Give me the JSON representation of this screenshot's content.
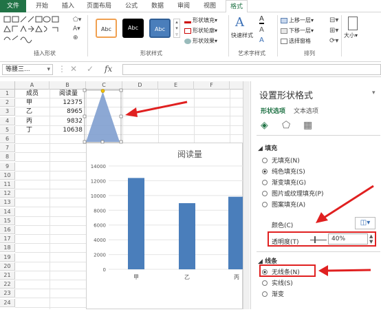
{
  "ribbon": {
    "tabs": [
      "文件",
      "开始",
      "插入",
      "页面布局",
      "公式",
      "数据",
      "审阅",
      "视图",
      "格式"
    ],
    "active_tab": "格式",
    "group_labels": {
      "insert_shapes": "插入形状",
      "shape_styles": "形状样式",
      "wordart": "艺术字样式",
      "arrange": "排列"
    },
    "style_samples": [
      "Abc",
      "Abc",
      "Abc"
    ],
    "shape_fill": "形状填充",
    "shape_outline": "形状轮廓",
    "shape_effects": "形状效果",
    "quick_styles": "快速样式",
    "bring_forward": "上移一层",
    "send_backward": "下移一层",
    "selection_pane": "选择窗格",
    "size": "大小"
  },
  "formula_bar": {
    "name_box": "等腰三...",
    "fx": "fx",
    "value": ""
  },
  "grid": {
    "columns": [
      "A",
      "B",
      "C",
      "D",
      "E",
      "F"
    ],
    "rows": [
      "1",
      "2",
      "3",
      "4",
      "5",
      "6",
      "7",
      "8",
      "9",
      "10",
      "11",
      "12",
      "13",
      "14",
      "15",
      "16",
      "17",
      "18",
      "19",
      "20",
      "21",
      "22",
      "23",
      "24"
    ],
    "cells": [
      {
        "a": "成员",
        "b": "阅读量"
      },
      {
        "a": "甲",
        "b": "12375"
      },
      {
        "a": "乙",
        "b": "8965"
      },
      {
        "a": "丙",
        "b": "9832"
      },
      {
        "a": "丁",
        "b": "10638"
      }
    ]
  },
  "chart_data": {
    "type": "bar",
    "title": "阅读量",
    "categories": [
      "甲",
      "乙",
      "丙"
    ],
    "values": [
      12375,
      8965,
      9832
    ],
    "yticks": [
      "0",
      "2000",
      "4000",
      "6000",
      "8000",
      "10000",
      "12000",
      "14000"
    ],
    "ylim": [
      0,
      14000
    ]
  },
  "pane": {
    "title": "设置形状格式",
    "tabs": [
      "形状选项",
      "文本选项"
    ],
    "fill_section": "填充",
    "fill_options": [
      "无填充(N)",
      "纯色填充(S)",
      "渐变填充(G)",
      "图片或纹理填充(P)",
      "图案填充(A)"
    ],
    "fill_selected": 1,
    "color_label": "颜色(C)",
    "transparency_label": "透明度(T)",
    "transparency_value": "40%",
    "line_section": "线条",
    "line_options": [
      "无线条(N)",
      "实线(S)",
      "渐变"
    ],
    "line_selected": 0
  },
  "colors": {
    "accent": "#217346",
    "bar": "#4a7ebb",
    "triangle": "#7f9fcf",
    "highlight": "#e02020"
  }
}
